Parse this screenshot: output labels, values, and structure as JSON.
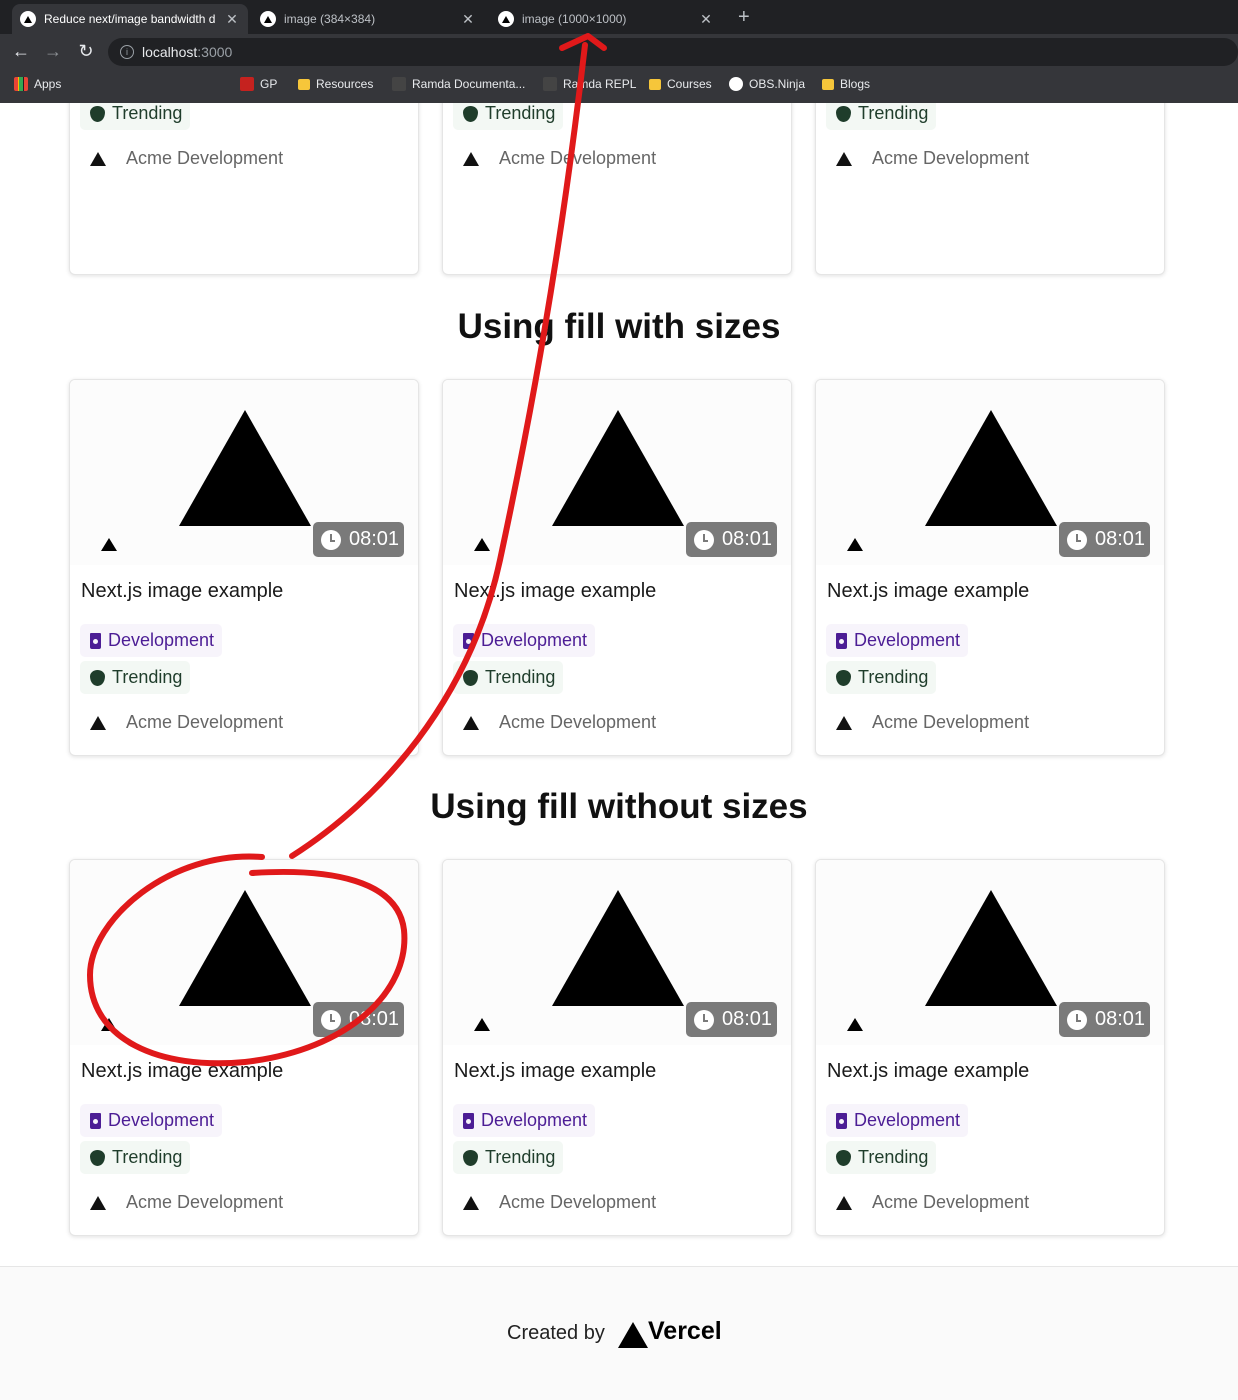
{
  "browser": {
    "tabs": [
      {
        "title": "Reduce next/image bandwidth d",
        "active": true
      },
      {
        "title": "image (384×384)",
        "active": false
      },
      {
        "title": "image (1000×1000)",
        "active": false
      }
    ],
    "new_tab": "+",
    "address": {
      "host": "localhost",
      "port": ":3000"
    },
    "bookmarks": [
      "Apps",
      "GP",
      "Resources",
      "Ramda Documenta...",
      "Ramda REPL",
      "Courses",
      "OBS.Ninja",
      "Blogs"
    ]
  },
  "sections": [
    {
      "heading": ""
    },
    {
      "heading": "Using fill with sizes"
    },
    {
      "heading": "Using fill without sizes"
    }
  ],
  "card": {
    "title": "Next.js image example",
    "time": "08:01",
    "tags": [
      "Development",
      "Trending"
    ],
    "author": "Acme Development"
  },
  "footer": {
    "created_by": "Created by",
    "brand": "Vercel"
  },
  "colors": {
    "tag_dev": "#4c1d95",
    "tag_trend": "#1f3d2b",
    "annotation": "#e0191a",
    "chrome_bg": "#202124"
  },
  "icons": [
    "back-icon",
    "forward-icon",
    "reload-icon",
    "info-icon",
    "clock-icon",
    "cup-icon",
    "strawberry-icon",
    "acme-triangle-icon",
    "vercel-logo-icon"
  ]
}
